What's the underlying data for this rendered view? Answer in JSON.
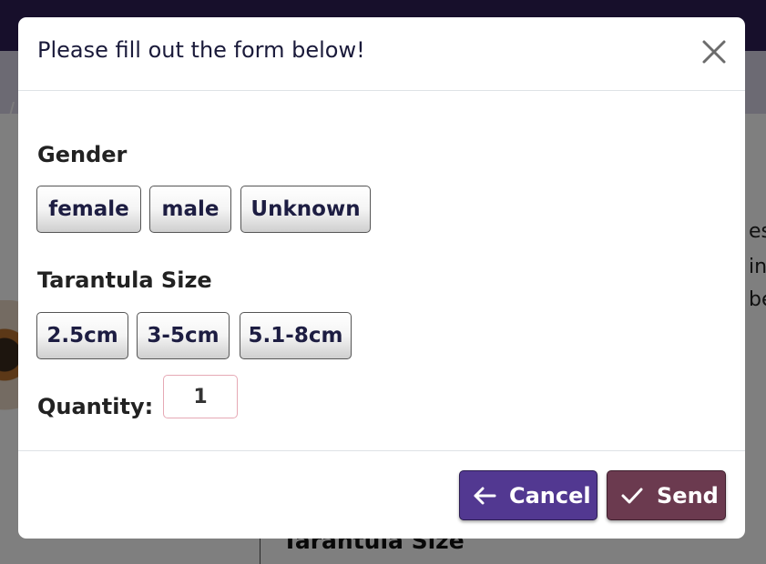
{
  "background": {
    "text_fragments": [
      "esi",
      "in",
      "be"
    ],
    "heading": "Tarantula Size"
  },
  "modal": {
    "title": "Please fill out the form below!",
    "close_icon": "close-icon",
    "gender": {
      "label": "Gender",
      "options": [
        "female",
        "male",
        "Unknown"
      ]
    },
    "size": {
      "label": "Tarantula Size",
      "options": [
        "2.5cm",
        "3-5cm",
        "5.1-8cm"
      ]
    },
    "quantity": {
      "label": "Quantity:",
      "value": "1"
    },
    "footer": {
      "cancel_label": "Cancel",
      "cancel_icon": "arrow-left-icon",
      "send_label": "Send",
      "send_icon": "check-icon"
    }
  },
  "colors": {
    "topbar": "#2e1f57",
    "cancel_button": "#523891",
    "send_button": "#6b3a4f"
  }
}
